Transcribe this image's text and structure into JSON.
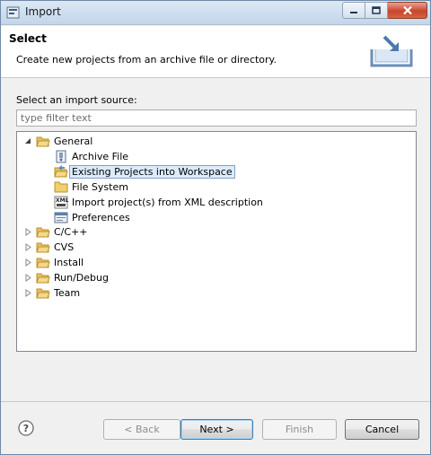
{
  "window": {
    "title": "Import"
  },
  "header": {
    "title": "Select",
    "description": "Create new projects from an archive file or directory."
  },
  "source": {
    "label": "Select an import source:",
    "filter_placeholder": "type filter text",
    "filter_value": ""
  },
  "tree": {
    "general": {
      "label": "General",
      "expanded": true,
      "children": [
        {
          "label": "Archive File",
          "icon": "archive-file-icon"
        },
        {
          "label": "Existing Projects into Workspace",
          "icon": "existing-projects-icon",
          "selected": true
        },
        {
          "label": "File System",
          "icon": "folder-icon"
        },
        {
          "label": "Import project(s) from XML description",
          "icon": "xml-icon"
        },
        {
          "label": "Preferences",
          "icon": "preferences-icon"
        }
      ]
    },
    "collapsed": [
      {
        "label": "C/C++"
      },
      {
        "label": "CVS"
      },
      {
        "label": "Install"
      },
      {
        "label": "Run/Debug"
      },
      {
        "label": "Team"
      }
    ]
  },
  "buttons": {
    "back": "< Back",
    "next": "Next >",
    "finish": "Finish",
    "cancel": "Cancel"
  },
  "colors": {
    "selection_bg": "#dcebfc",
    "selection_border": "#7da2ce",
    "folder": "#e8c063"
  }
}
